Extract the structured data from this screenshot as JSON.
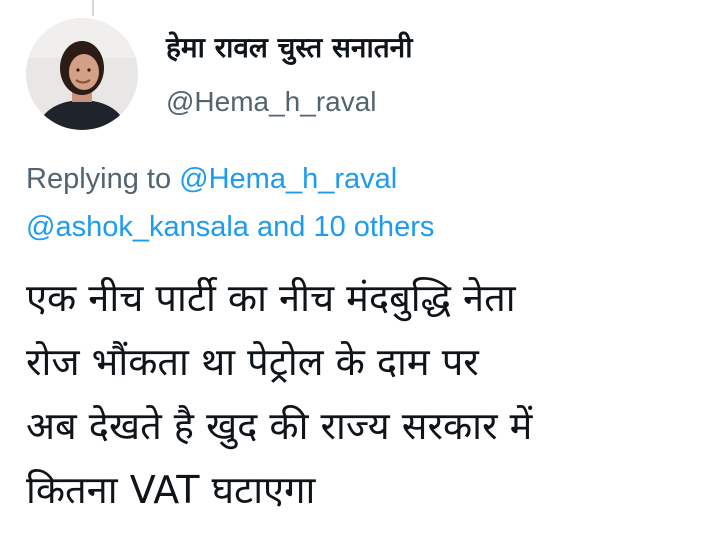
{
  "author": {
    "display_name": "हेमा रावल चुस्त सनातनी",
    "handle": "@Hema_h_raval"
  },
  "reply_context": {
    "prefix": "Replying to",
    "first_mention": "@Hema_h_raval",
    "mention_two": "@ashok_kansala",
    "joiner": "and",
    "others": "10 others"
  },
  "tweet": {
    "lines": [
      "एक नीच पार्टी का नीच मंदबुद्धि नेता",
      "रोज भौंकता था पेट्रोल के दाम पर",
      "अब देखते है खुद की राज्य सरकार में",
      "कितना VAT घटाएगा"
    ]
  },
  "colors": {
    "text": "#0f1419",
    "secondary": "#536471",
    "link": "#1d9bf0"
  },
  "icons": {
    "avatar": "profile-photo"
  }
}
